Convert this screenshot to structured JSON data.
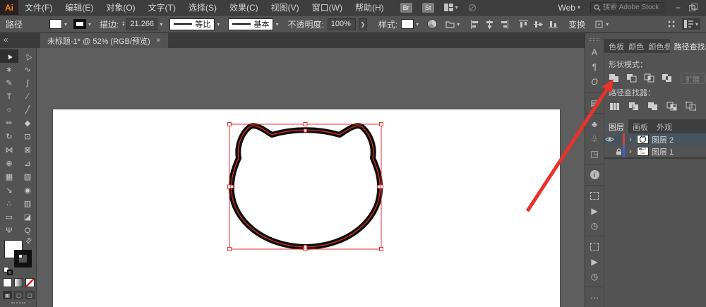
{
  "colors": {
    "menubar-bg": "#3e3e3e",
    "bar-bg": "#535353",
    "tabbar-bg": "#3a3a3a",
    "canvas-bg": "#5e5e5e",
    "panel-bg": "#535353",
    "panel-dark": "#3d3d3d",
    "active-tool-bg": "#2f2f2f",
    "text-light": "#d8d8d8",
    "text-dim": "#9f9f9f",
    "accent-red": "#e8322c",
    "layer-red": "#e0402f",
    "layer-blue": "#3f62d7",
    "selected-row": "#47545e",
    "logo-orange": "#ff7f18",
    "logo-bg": "#262120",
    "input-bg": "#464646",
    "border-dark": "#2e2e2e",
    "icon-gray": "#c6c6c6",
    "artboard": "#ffffff",
    "stroke-black": "#0e0e0e"
  },
  "menu_bar": {
    "logo": "Ai",
    "items": [
      "文件(F)",
      "编辑(E)",
      "对象(O)",
      "文字(T)",
      "选择(S)",
      "效果(C)",
      "视图(V)",
      "窗口(W)",
      "帮助(H)"
    ],
    "bridge_badge": "Br",
    "stock_badge": "St",
    "workspace_label": "Web",
    "search_placeholder": "搜索 Adobe Stock",
    "minimize_glyph": "−"
  },
  "control_bar": {
    "context_label": "路径",
    "stroke_label": "描边:",
    "stroke_value": "21.266",
    "profile_label": "等比",
    "brush_label": "基本",
    "opacity_label": "不透明度:",
    "opacity_value": "100%",
    "opacity_more": "❯",
    "style_label": "样式:",
    "transform_label": "变换"
  },
  "tab_bar": {
    "collapse_glyph": "«",
    "document_title": "未标题-1* @ 52% (RGB/预览)",
    "close_glyph": "✕"
  },
  "tools": [
    {
      "name": "selection-tool",
      "glyph": "▲"
    },
    {
      "name": "direct-selection-tool",
      "glyph": "△"
    },
    {
      "name": "magic-wand-tool",
      "glyph": "∗"
    },
    {
      "name": "lasso-tool",
      "glyph": "∿"
    },
    {
      "name": "pen-tool",
      "glyph": "✎"
    },
    {
      "name": "curvature-tool",
      "glyph": "∫"
    },
    {
      "name": "type-tool",
      "glyph": "T"
    },
    {
      "name": "line-segment-tool",
      "glyph": "∕"
    },
    {
      "name": "ellipse-tool",
      "glyph": "○"
    },
    {
      "name": "paintbrush-tool",
      "glyph": "╱"
    },
    {
      "name": "pencil-tool",
      "glyph": "✏"
    },
    {
      "name": "shaper-tool",
      "glyph": "◆"
    },
    {
      "name": "rotate-tool",
      "glyph": "↻"
    },
    {
      "name": "scale-tool",
      "glyph": "⊡"
    },
    {
      "name": "width-tool",
      "glyph": "⋈"
    },
    {
      "name": "free-transform-tool",
      "glyph": "⊠"
    },
    {
      "name": "shape-builder-tool",
      "glyph": "⊕"
    },
    {
      "name": "perspective-grid-tool",
      "glyph": "⊿"
    },
    {
      "name": "mesh-tool",
      "glyph": "▦"
    },
    {
      "name": "gradient-tool",
      "glyph": "▨"
    },
    {
      "name": "eyedropper-tool",
      "glyph": "↘"
    },
    {
      "name": "blend-tool",
      "glyph": "◉"
    },
    {
      "name": "symbol-sprayer-tool",
      "glyph": "∴"
    },
    {
      "name": "column-graph-tool",
      "glyph": "▥"
    },
    {
      "name": "artboard-tool",
      "glyph": "▭"
    },
    {
      "name": "slice-tool",
      "glyph": "◪"
    },
    {
      "name": "hand-tool",
      "glyph": "Ψ"
    },
    {
      "name": "zoom-tool",
      "glyph": "Q"
    }
  ],
  "dock_strip": [
    {
      "name": "character-panel-icon",
      "glyph": "A"
    },
    {
      "name": "paragraph-panel-icon",
      "glyph": "¶"
    },
    {
      "name": "opentype-panel-icon",
      "glyph": "O"
    },
    {
      "name": "libraries-panel-icon",
      "glyph": "▤"
    },
    {
      "name": "symbols-panel-icon",
      "glyph": "♣"
    },
    {
      "name": "brushes-panel-icon",
      "glyph": "♧"
    },
    {
      "name": "asset-export-panel-icon",
      "glyph": "◳"
    },
    {
      "name": "info-panel-icon",
      "glyph": "i"
    },
    {
      "name": "actions-panel-icon",
      "glyph": ""
    },
    {
      "name": "play-icon",
      "glyph": "▶"
    },
    {
      "name": "history-panel-icon",
      "glyph": "◷"
    },
    {
      "name": "actions-panel-icon-2",
      "glyph": ""
    },
    {
      "name": "play-icon-2",
      "glyph": "▶"
    },
    {
      "name": "history-panel-icon-2",
      "glyph": "◷"
    },
    {
      "name": "more-panels-icon",
      "glyph": "⋯"
    }
  ],
  "pathfinder_panel": {
    "inactive_tabs": [
      "色板",
      "颜色",
      "颜色参"
    ],
    "active_tab": "路径查找器",
    "shape_modes_label": "形状模式：",
    "shape_mode_buttons": [
      "unite",
      "minus-front",
      "intersect",
      "exclude"
    ],
    "expand_button": "扩展",
    "pathfinder_label": "路径查找器：",
    "pathfinder_buttons": [
      "divide",
      "trim",
      "merge",
      "crop",
      "outline"
    ]
  },
  "layers_panel": {
    "tabs": [
      "图层",
      "画板",
      "外观"
    ],
    "active_tab": "图层",
    "rows": [
      {
        "label": "图层 2",
        "color": "#e0402f",
        "visible": true,
        "locked": false,
        "selected": true
      },
      {
        "label": "图层 1",
        "color": "#3f62d7",
        "visible": false,
        "locked": true,
        "selected": false
      }
    ]
  },
  "canvas": {
    "zoom_percent": "52%",
    "artwork": "cat-head-outline",
    "annotation": "red-arrow-pointing-to-pathfinder-panel"
  }
}
